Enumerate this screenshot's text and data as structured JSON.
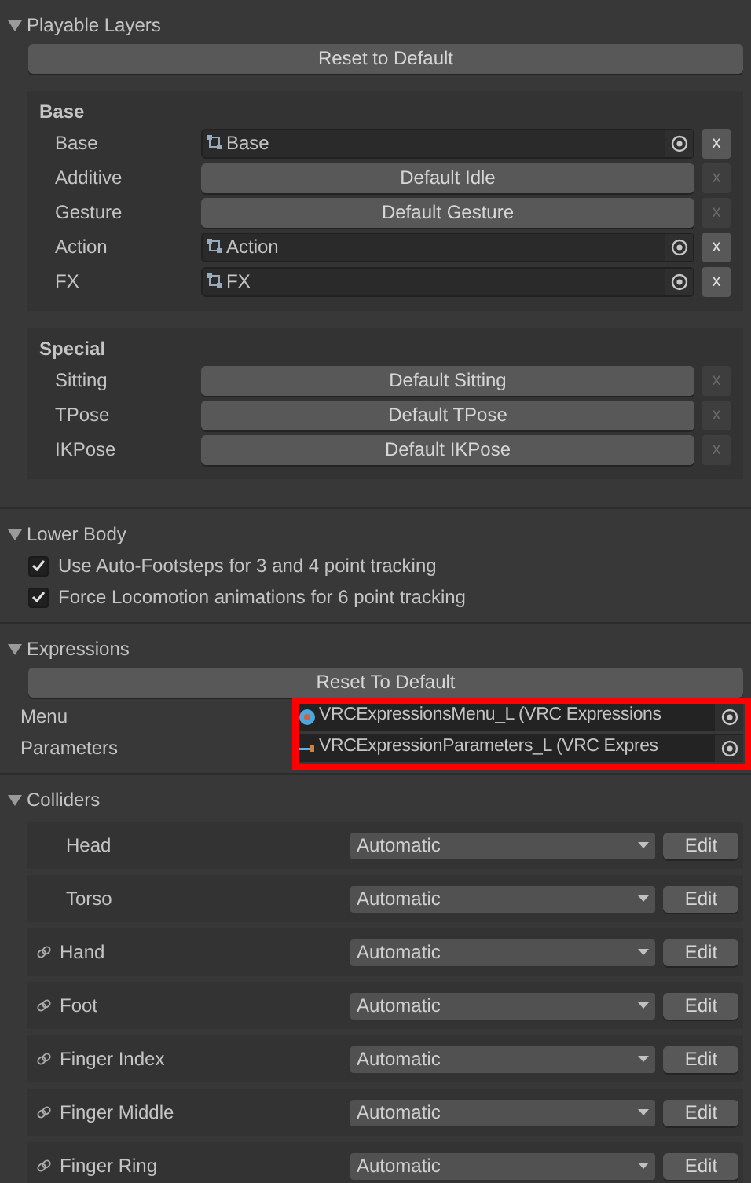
{
  "sections": [
    {
      "kind": "layers",
      "title": "Playable Layers",
      "expanded": true,
      "reset_button": "Reset to Default",
      "groups": [
        {
          "title": "Base",
          "rows": [
            {
              "label": "Base",
              "kind": "object",
              "value": "Base",
              "clear_disabled": false,
              "clear": "x"
            },
            {
              "label": "Additive",
              "kind": "default",
              "value": "Default Idle",
              "clear_disabled": true,
              "clear": "x"
            },
            {
              "label": "Gesture",
              "kind": "default",
              "value": "Default Gesture",
              "clear_disabled": true,
              "clear": "x"
            },
            {
              "label": "Action",
              "kind": "object",
              "value": "Action",
              "clear_disabled": false,
              "clear": "x"
            },
            {
              "label": "FX",
              "kind": "object",
              "value": "FX",
              "clear_disabled": false,
              "clear": "x"
            }
          ]
        },
        {
          "title": "Special",
          "rows": [
            {
              "label": "Sitting",
              "kind": "default",
              "value": "Default Sitting",
              "clear_disabled": true,
              "clear": "x"
            },
            {
              "label": "TPose",
              "kind": "default",
              "value": "Default TPose",
              "clear_disabled": true,
              "clear": "x"
            },
            {
              "label": "IKPose",
              "kind": "default",
              "value": "Default IKPose",
              "clear_disabled": true,
              "clear": "x"
            }
          ]
        }
      ]
    },
    {
      "kind": "checks",
      "title": "Lower Body",
      "expanded": true,
      "options": [
        {
          "label": "Use Auto-Footsteps for 3 and 4 point tracking",
          "checked": true
        },
        {
          "label": "Force Locomotion animations for 6 point tracking",
          "checked": true
        }
      ]
    },
    {
      "kind": "expressions",
      "title": "Expressions",
      "expanded": true,
      "reset_button": "Reset To Default",
      "highlighted": true,
      "fields": [
        {
          "label": "Menu",
          "kind": "menu",
          "value": "VRCExpressionsMenu_L (VRC Expressions"
        },
        {
          "label": "Parameters",
          "kind": "parameters",
          "value": "VRCExpressionParameters_L (VRC Expres"
        }
      ]
    },
    {
      "kind": "colliders",
      "title": "Colliders",
      "expanded": true,
      "rows": [
        {
          "label": "Head",
          "linked": false,
          "mode": "Automatic",
          "button": "Edit"
        },
        {
          "label": "Torso",
          "linked": false,
          "mode": "Automatic",
          "button": "Edit"
        },
        {
          "label": "Hand",
          "linked": true,
          "mode": "Automatic",
          "button": "Edit"
        },
        {
          "label": "Foot",
          "linked": true,
          "mode": "Automatic",
          "button": "Edit"
        },
        {
          "label": "Finger Index",
          "linked": true,
          "mode": "Automatic",
          "button": "Edit"
        },
        {
          "label": "Finger Middle",
          "linked": true,
          "mode": "Automatic",
          "button": "Edit"
        },
        {
          "label": "Finger Ring",
          "linked": true,
          "mode": "Automatic",
          "button": "Edit"
        }
      ]
    }
  ]
}
